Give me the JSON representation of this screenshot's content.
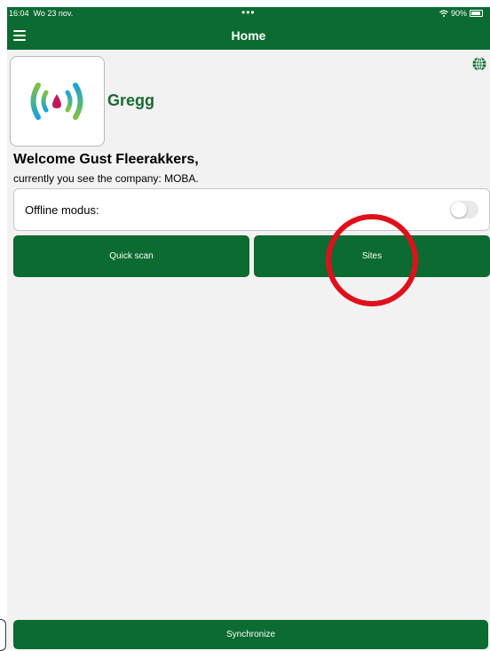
{
  "status_bar": {
    "time": "16:04",
    "date": "Wo 23 nov.",
    "dots": "•••",
    "battery": "90%"
  },
  "nav": {
    "title": "Home"
  },
  "brand": {
    "name": "Gregg"
  },
  "welcome": {
    "heading": "Welcome Gust Fleerakkers,",
    "subtext": "currently you see the company: MOBA."
  },
  "offline": {
    "label": "Offline modus:",
    "enabled": false
  },
  "buttons": {
    "quick_scan": "Quick scan",
    "sites": "Sites",
    "synchronize": "Synchronize"
  },
  "colors": {
    "primary": "#0b6b31",
    "highlight": "#e0101b",
    "background": "#f2f2f2"
  },
  "icons": [
    "menu-icon",
    "globe-icon",
    "wifi-icon",
    "battery-icon",
    "signal-logo"
  ]
}
